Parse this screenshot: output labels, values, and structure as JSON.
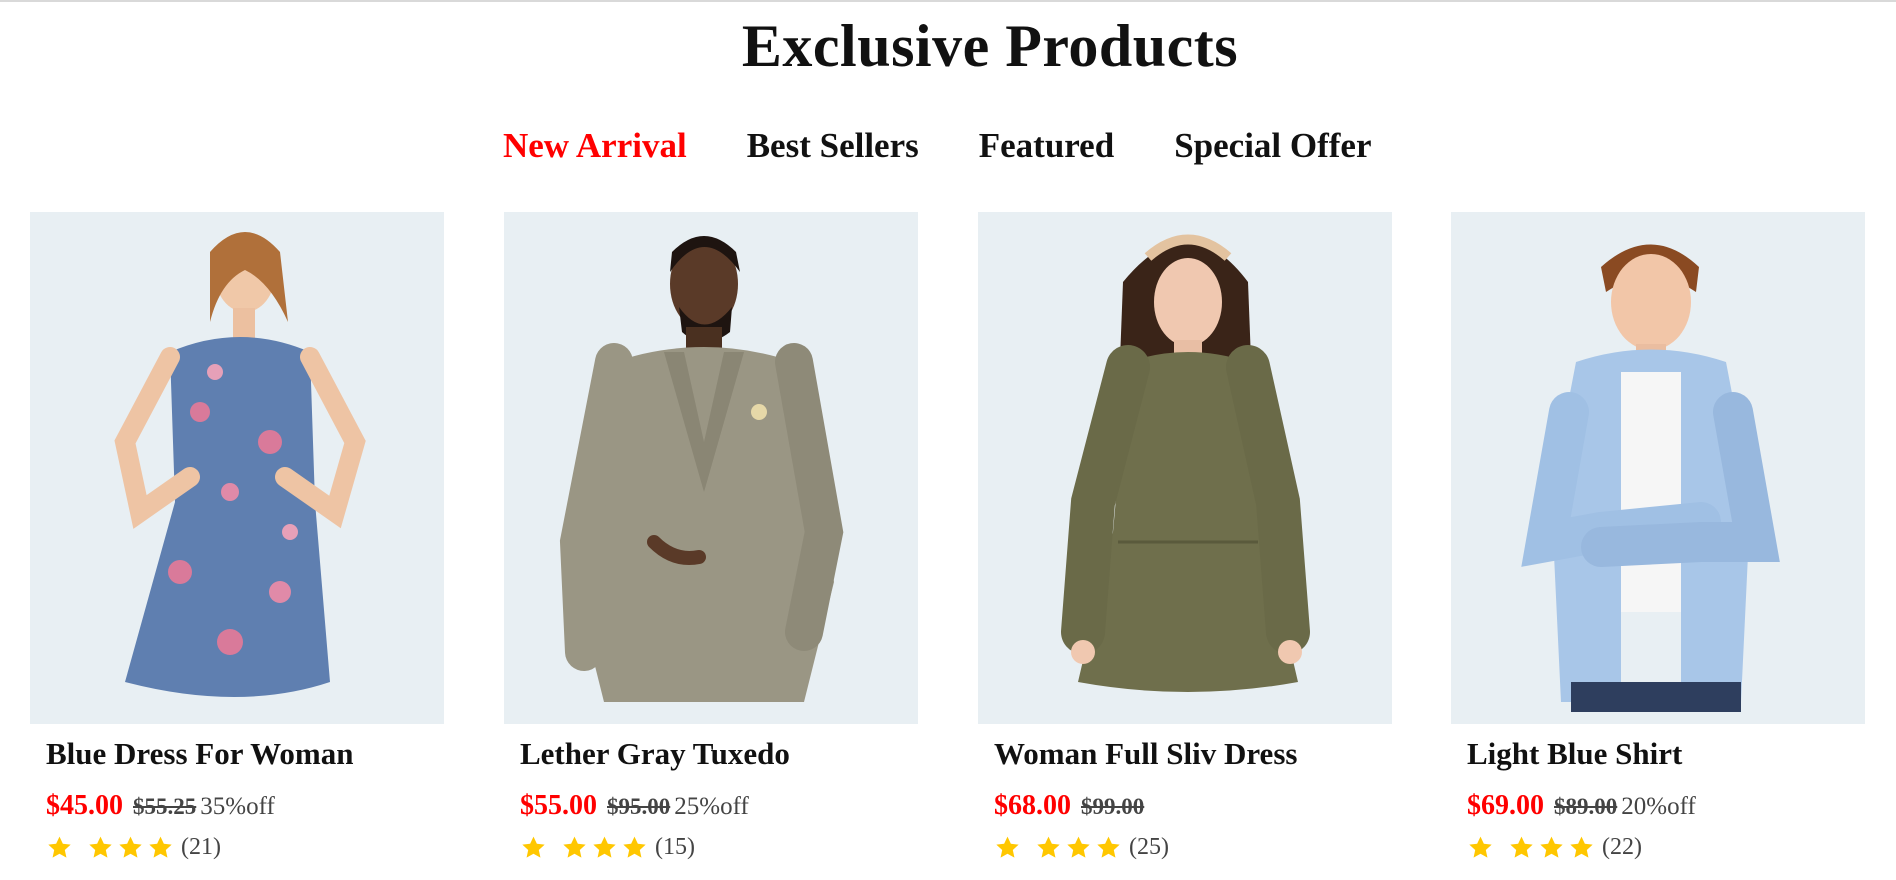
{
  "heading": "Exclusive Products",
  "tabs": [
    {
      "label": "New Arrival",
      "active": true
    },
    {
      "label": "Best Sellers",
      "active": false
    },
    {
      "label": "Featured",
      "active": false
    },
    {
      "label": "Special Offer",
      "active": false
    }
  ],
  "colors": {
    "accent": "#ff0000",
    "star": "#ffc700",
    "image_bg": "#e8eff3"
  },
  "products": [
    {
      "name": "Blue Dress For Woman",
      "price": "$45.00",
      "old_price": "$55.25",
      "discount": "35%off",
      "rating_count": "(21)",
      "stars": 4,
      "image": "woman-floral-dress-photo"
    },
    {
      "name": "Lether Gray Tuxedo",
      "price": "$55.00",
      "old_price": "$95.00",
      "discount": "25%off",
      "rating_count": "(15)",
      "stars": 4,
      "image": "man-gray-tweed-jacket-photo"
    },
    {
      "name": "Woman Full Sliv Dress",
      "price": "$68.00",
      "old_price": "$99.00",
      "discount": "",
      "rating_count": "(25)",
      "stars": 4,
      "image": "woman-olive-dress-photo"
    },
    {
      "name": "Light Blue Shirt",
      "price": "$69.00",
      "old_price": "$89.00",
      "discount": "20%off",
      "rating_count": "(22)",
      "stars": 4,
      "image": "boy-light-blue-shirt-photo"
    }
  ]
}
